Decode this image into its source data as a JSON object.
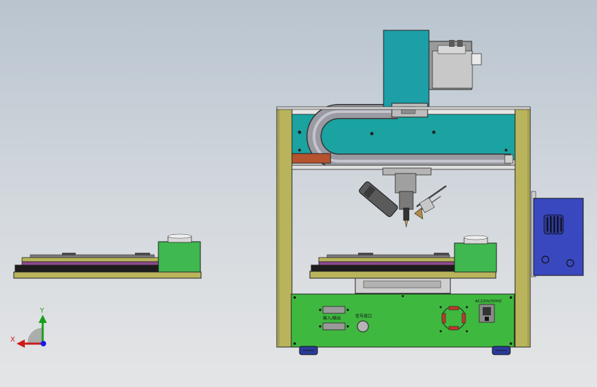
{
  "panel": {
    "label_io": "输入/输出",
    "label_port": "信号接口",
    "label_power": "AC220V/50HZ"
  },
  "triad": {
    "x_label": "X",
    "y_label": "Y"
  },
  "colors": {
    "frame_yellow": "#b9b45c",
    "gantry_teal": "#1aa3a0",
    "panel_green": "#3fb83f",
    "enclosure_blue": "#3a48c0",
    "copper": "#b5532f",
    "background": "#c9d0d8"
  }
}
